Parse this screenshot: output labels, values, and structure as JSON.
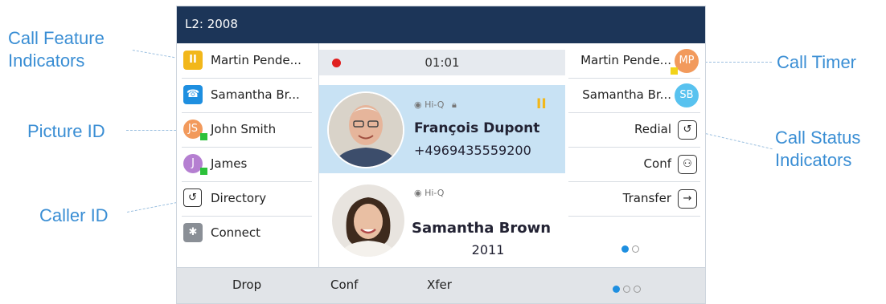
{
  "callouts": {
    "call_feature_indicators": "Call Feature\nIndicators",
    "picture_id": "Picture ID",
    "caller_id": "Caller ID",
    "call_timer": "Call Timer",
    "call_status_indicators": "Call Status\nIndicators"
  },
  "topbar": {
    "line_label": "L2: 2008"
  },
  "left_keys": [
    {
      "label": "Martin Pende...",
      "icon": "hold-icon",
      "icon_glyph": "II",
      "color": "#f2b71a"
    },
    {
      "label": "Samantha Br...",
      "icon": "phone-icon",
      "icon_glyph": "☎",
      "color": "#1e8fe0"
    },
    {
      "label": "John Smith",
      "icon": "avatar",
      "icon_glyph": "JS",
      "color": "#f29a5c"
    },
    {
      "label": "James",
      "icon": "avatar",
      "icon_glyph": "J",
      "color": "#b57fd1"
    },
    {
      "label": "Directory",
      "icon": "directory-icon",
      "icon_glyph": "↺"
    },
    {
      "label": "Connect",
      "icon": "bluetooth-icon",
      "icon_glyph": "ʙ",
      "color": "#8a8f96"
    }
  ],
  "center": {
    "timer": "01:01",
    "active_call": {
      "hiq": "Hi-Q",
      "name": "François Dupont",
      "number": "+4969435559200"
    },
    "second_call": {
      "hiq": "Hi-Q",
      "name": "Samantha Brown",
      "number": "2011"
    }
  },
  "right_keys": [
    {
      "label": "Martin Pende...",
      "avatar": "MP",
      "color": "#f29a5c"
    },
    {
      "label": "Samantha Br...",
      "avatar": "SB",
      "color": "#58c2ef"
    },
    {
      "label": "Redial",
      "icon": "redial-icon",
      "glyph": "↺"
    },
    {
      "label": "Conf",
      "icon": "conference-icon",
      "glyph": "⚇"
    },
    {
      "label": "Transfer",
      "icon": "transfer-icon",
      "glyph": "→"
    }
  ],
  "softkeys": {
    "drop": "Drop",
    "conf": "Conf",
    "xfer": "Xfer"
  },
  "colors": {
    "accent": "#3a8ed4",
    "topbar": "#1c3558",
    "active_call_bg": "#c8e2f4",
    "page_dot": "#1e8fe0"
  }
}
